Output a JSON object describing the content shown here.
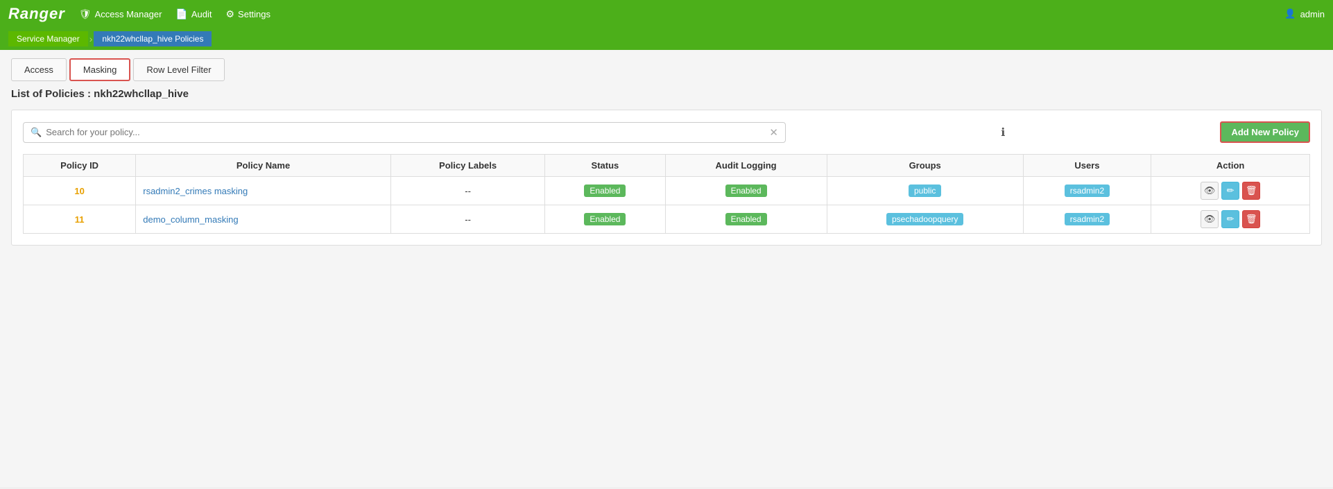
{
  "brand": "Ranger",
  "navbar": {
    "items": [
      {
        "label": "Access Manager",
        "icon": "🛡"
      },
      {
        "label": "Audit",
        "icon": "📄"
      },
      {
        "label": "Settings",
        "icon": "⚙"
      }
    ],
    "user": "admin",
    "user_icon": "👤"
  },
  "breadcrumb": {
    "items": [
      {
        "label": "Service Manager",
        "active": false
      },
      {
        "label": "nkh22whcllap_hive Policies",
        "active": true
      }
    ]
  },
  "tabs": [
    {
      "label": "Access",
      "active": false
    },
    {
      "label": "Masking",
      "active": true
    },
    {
      "label": "Row Level Filter",
      "active": false
    }
  ],
  "page_title": "List of Policies : nkh22whcllap_hive",
  "search": {
    "placeholder": "Search for your policy...",
    "value": "",
    "info_icon": "ℹ"
  },
  "add_button_label": "Add New Policy",
  "table": {
    "columns": [
      "Policy ID",
      "Policy Name",
      "Policy Labels",
      "Status",
      "Audit Logging",
      "Groups",
      "Users",
      "Action"
    ],
    "rows": [
      {
        "id": "10",
        "name": "rsadmin2_crimes masking",
        "labels": "--",
        "status": "Enabled",
        "audit_logging": "Enabled",
        "groups": "public",
        "users": "rsadmin2"
      },
      {
        "id": "11",
        "name": "demo_column_masking",
        "labels": "--",
        "status": "Enabled",
        "audit_logging": "Enabled",
        "groups": "psechadoopquery",
        "users": "rsadmin2"
      }
    ]
  },
  "icons": {
    "view": "👁",
    "edit": "✏",
    "delete": "🗑",
    "search": "🔍",
    "clear": "✕"
  }
}
